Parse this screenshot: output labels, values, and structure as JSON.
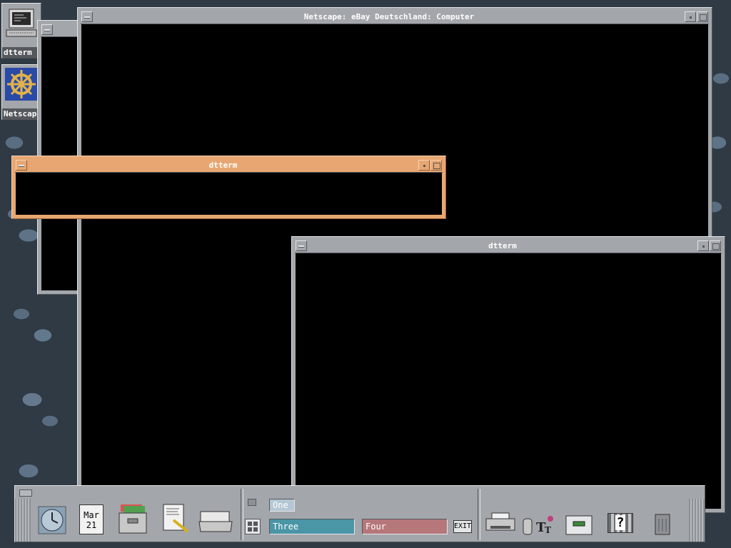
{
  "desktop": {
    "icons": [
      {
        "label": "dtterm",
        "icon": "terminal-icon"
      },
      {
        "label": "Netscape",
        "icon": "ships-wheel-icon"
      }
    ]
  },
  "windows": {
    "netscape": {
      "title": "Netscape: eBay Deutschland: Computer"
    },
    "dtterm_active": {
      "title": "dtterm"
    },
    "dtterm_lower": {
      "title": "dtterm"
    }
  },
  "panel": {
    "calendar": {
      "month": "Mar",
      "day": "21"
    },
    "workspaces": [
      {
        "label": "One",
        "color": "#b5c7d4"
      },
      {
        "label": "Three",
        "color": "#4a95a6"
      },
      {
        "label": "Four",
        "color": "#b6777b"
      }
    ],
    "exit_label": "EXIT",
    "help_label": "?"
  },
  "colors": {
    "active_frame": "#e8a772",
    "inactive_frame": "#a3a6aa"
  }
}
